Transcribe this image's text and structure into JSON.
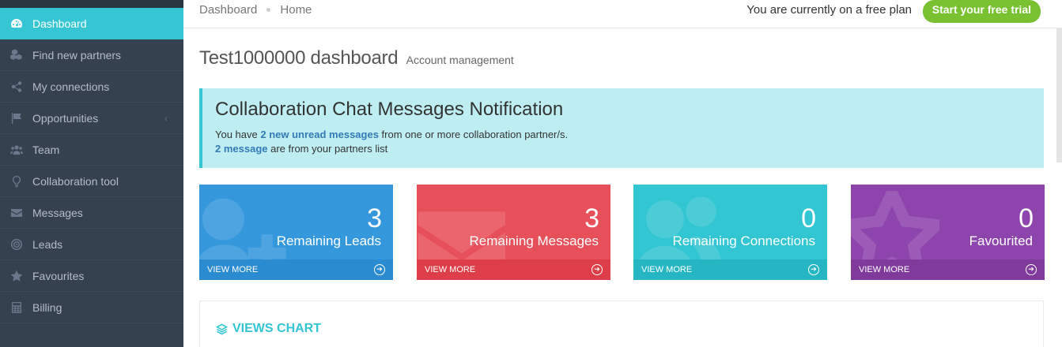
{
  "sidebar": {
    "items": [
      {
        "label": "Dashboard",
        "icon": "dashboard-icon",
        "active": true
      },
      {
        "label": "Find new partners",
        "icon": "cubes-icon"
      },
      {
        "label": "My connections",
        "icon": "share-icon"
      },
      {
        "label": "Opportunities",
        "icon": "flag-icon",
        "caret": "‹"
      },
      {
        "label": "Team",
        "icon": "users-icon"
      },
      {
        "label": "Collaboration tool",
        "icon": "bulb-icon"
      },
      {
        "label": "Messages",
        "icon": "envelope-icon"
      },
      {
        "label": "Leads",
        "icon": "target-icon"
      },
      {
        "label": "Favourites",
        "icon": "star-icon"
      },
      {
        "label": "Billing",
        "icon": "calculator-icon"
      }
    ]
  },
  "topbar": {
    "breadcrumb": [
      "Dashboard",
      "Home"
    ],
    "plan_text": "You are currently on a free plan",
    "trial_button": "Start your free trial"
  },
  "page": {
    "title": "Test1000000 dashboard",
    "subtitle": "Account management"
  },
  "notification": {
    "title": "Collaboration Chat Messages Notification",
    "line1_prefix": "You have ",
    "line1_link": "2 new unread messages",
    "line1_suffix": " from one or more collaboration partner/s.",
    "line2_link": "2 message",
    "line2_suffix": " are from your partners list"
  },
  "tiles": [
    {
      "number": "3",
      "label": "Remaining Leads",
      "more": "VIEW MORE",
      "color": "#3598dc"
    },
    {
      "number": "3",
      "label": "Remaining Messages",
      "more": "VIEW MORE",
      "color": "#e7505a"
    },
    {
      "number": "0",
      "label": "Remaining Connections",
      "more": "VIEW MORE",
      "color": "#32c5d2"
    },
    {
      "number": "0",
      "label": "Favourited",
      "more": "VIEW MORE",
      "color": "#8e44ad"
    }
  ],
  "chart_panel": {
    "title": "VIEWS CHART",
    "icon": "layers-icon"
  }
}
